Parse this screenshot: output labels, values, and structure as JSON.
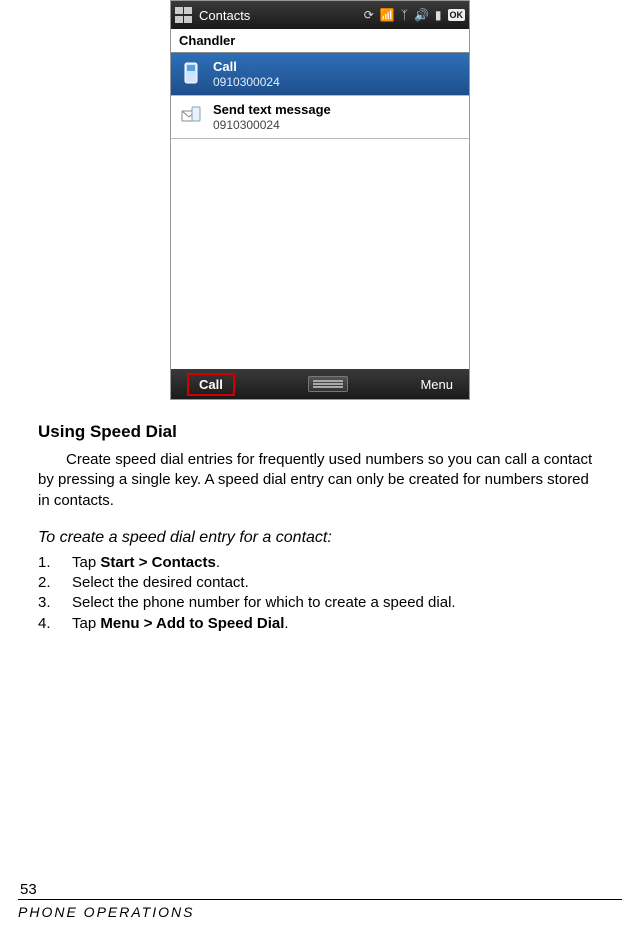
{
  "phone": {
    "statusbar_title": "Contacts",
    "ok_label": "OK",
    "contact_name": "Chandler",
    "items": [
      {
        "icon": "phone-icon",
        "title": "Call",
        "sub": "0910300024",
        "selected": true
      },
      {
        "icon": "sms-icon",
        "title": "Send text message",
        "sub": "0910300024",
        "selected": false
      }
    ],
    "softkeys": {
      "left": "Call",
      "right": "Menu"
    }
  },
  "doc": {
    "heading": "Using Speed Dial",
    "paragraph": "Create speed dial entries for frequently used numbers so you can call a contact by pressing a single key. A speed dial entry can only be created for numbers stored in contacts.",
    "subheading": "To create a speed dial entry for a contact:",
    "steps": [
      {
        "n": "1.",
        "pre": "Tap ",
        "bold": "Start > Contacts",
        "post": "."
      },
      {
        "n": "2.",
        "pre": "Select the desired contact.",
        "bold": "",
        "post": ""
      },
      {
        "n": "3.",
        "pre": "Select the phone number for which to create a speed dial.",
        "bold": "",
        "post": ""
      },
      {
        "n": "4.",
        "pre": "Tap ",
        "bold": "Menu > Add to Speed Dial",
        "post": "."
      }
    ]
  },
  "footer": {
    "page_number": "53",
    "chapter": "Phone Operations"
  }
}
